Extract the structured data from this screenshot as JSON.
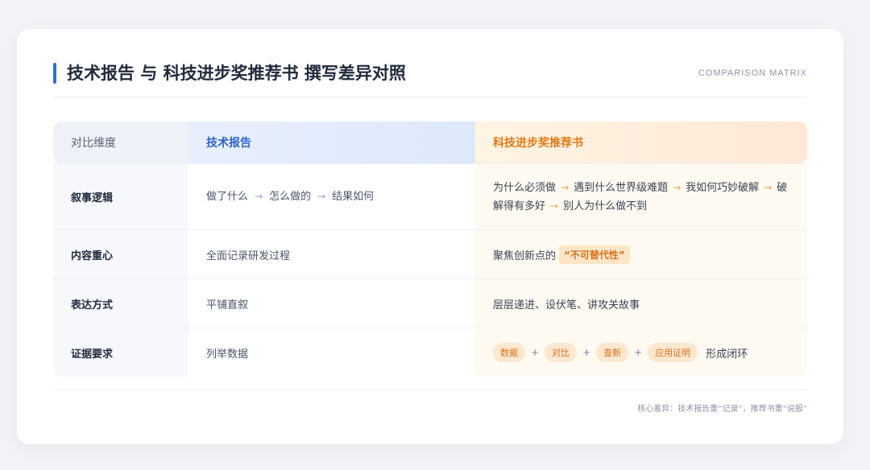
{
  "header": {
    "title": "技术报告 与 科技进步奖推荐书 撰写差异对照",
    "subtitle": "COMPARISON MATRIX"
  },
  "table": {
    "columns": [
      "对比维度",
      "技术报告",
      "科技进步奖推荐书"
    ],
    "rows": [
      {
        "dimension": "叙事逻辑",
        "report_steps": [
          "做了什么",
          "怎么做的",
          "结果如何"
        ],
        "recommend_steps": [
          "为什么必须做",
          "遇到什么世界级难题",
          "我如何巧妙破解",
          "破解得有多好",
          "别人为什么做不到"
        ]
      },
      {
        "dimension": "内容重心",
        "report": "全面记录研发过程",
        "recommend_prefix": "聚焦创新点的",
        "recommend_highlight": "“不可替代性”"
      },
      {
        "dimension": "表达方式",
        "report": "平铺直叙",
        "recommend": "层层递进、设伏笔、讲攻关故事"
      },
      {
        "dimension": "证据要求",
        "report": "列举数据",
        "recommend_pills": [
          "数据",
          "对比",
          "查新",
          "应用证明"
        ],
        "recommend_suffix": "形成闭环"
      }
    ]
  },
  "symbols": {
    "arrow": "→",
    "plus": "+"
  },
  "footer": {
    "note": "核心差异：技术报告重“记录”，推荐书重“说服”"
  },
  "colors": {
    "accent_blue": "#2f6fe6",
    "accent_orange": "#e07a16",
    "pill_bg": "#fde7cf"
  }
}
